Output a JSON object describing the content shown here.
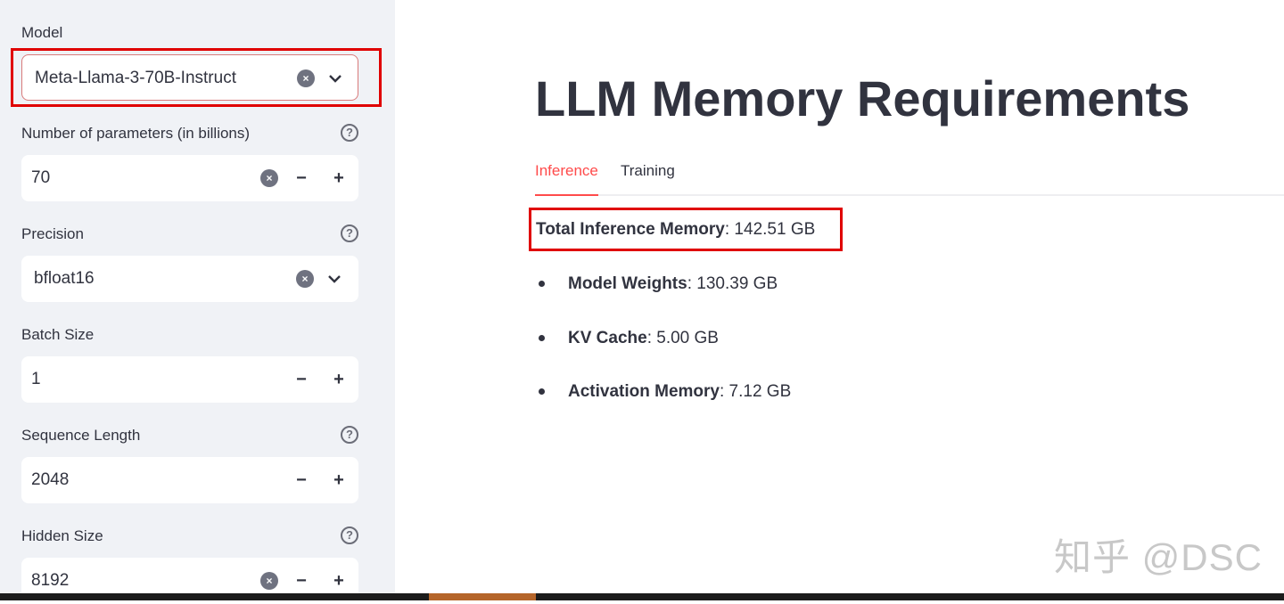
{
  "sidebar": {
    "fields": [
      {
        "label": "Model",
        "value": "Meta-Llama-3-70B-Instruct",
        "type": "select"
      },
      {
        "label": "Number of parameters (in billions)",
        "value": "70",
        "type": "number"
      },
      {
        "label": "Precision",
        "value": "bfloat16",
        "type": "select"
      },
      {
        "label": "Batch Size",
        "value": "1",
        "type": "number"
      },
      {
        "label": "Sequence Length",
        "value": "2048",
        "type": "number"
      },
      {
        "label": "Hidden Size",
        "value": "8192",
        "type": "number"
      }
    ],
    "help_glyph": "?",
    "clear_glyph": "×",
    "minus_glyph": "−",
    "plus_glyph": "+",
    "chevron_glyph": "⌄"
  },
  "main": {
    "title": "LLM Memory Requirements",
    "tabs": [
      {
        "label": "Inference"
      },
      {
        "label": "Training"
      }
    ],
    "total": {
      "label": "Total Inference Memory",
      "value": ": 142.51 GB"
    },
    "items": [
      {
        "label": "Model Weights",
        "value": ": 130.39 GB"
      },
      {
        "label": "KV Cache",
        "value": ": 5.00 GB"
      },
      {
        "label": "Activation Memory",
        "value": ": 7.12 GB"
      }
    ]
  },
  "watermark": "知乎 @DSC",
  "colors": {
    "accent": "#ff4b4b",
    "highlight": "#e00000",
    "sidebar_bg": "#f0f2f6"
  }
}
